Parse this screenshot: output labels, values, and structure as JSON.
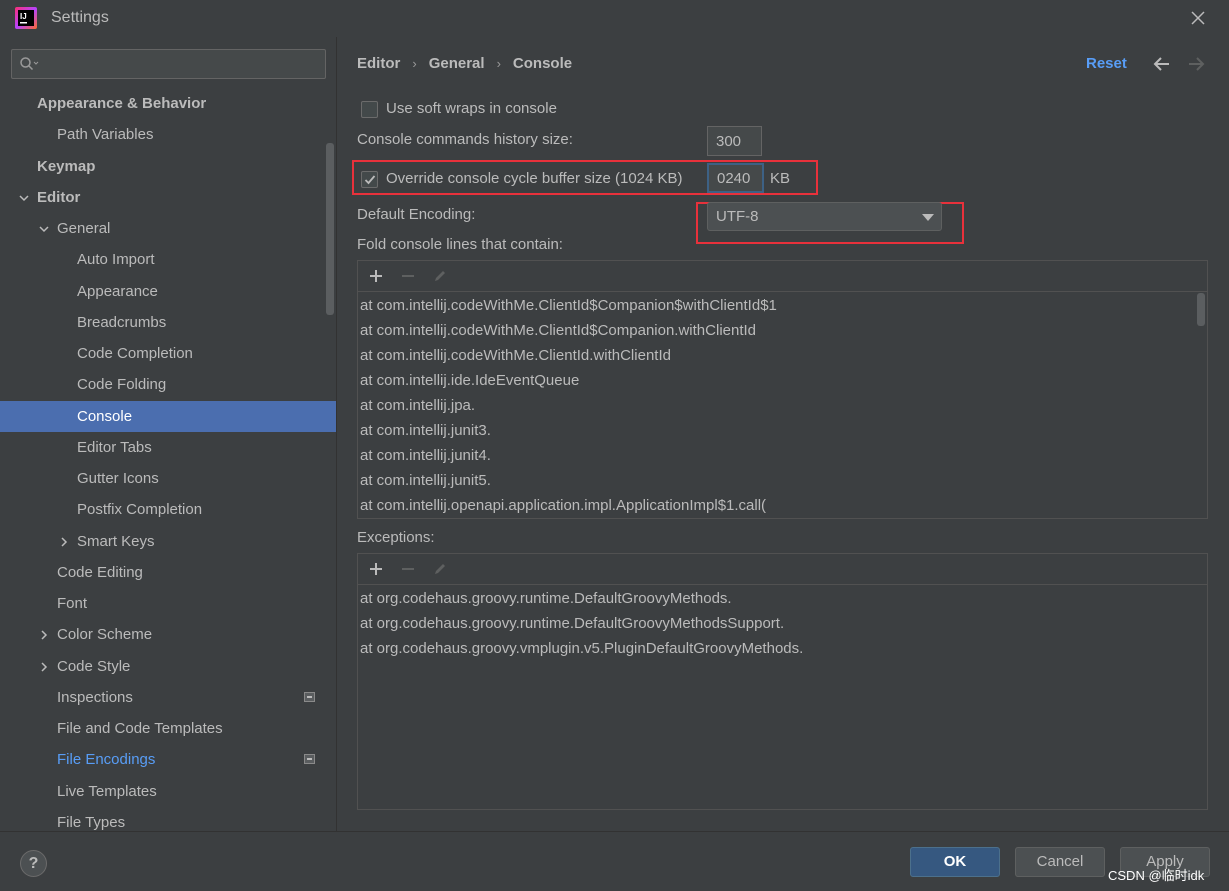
{
  "window": {
    "title": "Settings",
    "app_icon": "intellij-idea-icon",
    "close_icon": "close-icon"
  },
  "sidebar": {
    "search": {
      "value": "",
      "placeholder": ""
    },
    "items": [
      {
        "label": "Appearance & Behavior",
        "expanded": false,
        "selected": false
      },
      {
        "label": "Path Variables"
      },
      {
        "label": "Keymap"
      },
      {
        "label": "Editor",
        "expanded": true
      },
      {
        "label": "General",
        "expanded": true
      },
      {
        "label": "Auto Import"
      },
      {
        "label": "Appearance"
      },
      {
        "label": "Breadcrumbs"
      },
      {
        "label": "Code Completion"
      },
      {
        "label": "Code Folding"
      },
      {
        "label": "Console",
        "selected": true
      },
      {
        "label": "Editor Tabs"
      },
      {
        "label": "Gutter Icons"
      },
      {
        "label": "Postfix Completion"
      },
      {
        "label": "Smart Keys",
        "expanded": false
      },
      {
        "label": "Code Editing"
      },
      {
        "label": "Font"
      },
      {
        "label": "Color Scheme",
        "expanded": false
      },
      {
        "label": "Code Style",
        "expanded": false
      },
      {
        "label": "Inspections",
        "badge": "project-scope-icon"
      },
      {
        "label": "File and Code Templates"
      },
      {
        "label": "File Encodings",
        "badge": "project-scope-icon",
        "modified": true
      },
      {
        "label": "Live Templates"
      },
      {
        "label": "File Types"
      }
    ]
  },
  "breadcrumb": [
    "Editor",
    "General",
    "Console"
  ],
  "header": {
    "reset_label": "Reset",
    "back_icon": "arrow-left-icon",
    "forward_icon": "arrow-right-icon"
  },
  "settings": {
    "soft_wraps": {
      "label": "Use soft wraps in console",
      "checked": false
    },
    "history_size": {
      "label": "Console commands history size:",
      "value": "300"
    },
    "override_buffer": {
      "label": "Override console cycle buffer size (1024 KB)",
      "checked": true,
      "value": "0240",
      "unit": "KB"
    },
    "encoding": {
      "label": "Default Encoding:",
      "value": "UTF-8"
    },
    "fold_lines": {
      "label": "Fold console lines that contain:",
      "toolbar": [
        "add-icon",
        "remove-icon",
        "edit-icon"
      ],
      "rows": [
        "at com.intellij.codeWithMe.ClientId$Companion$withClientId$1",
        "at com.intellij.codeWithMe.ClientId$Companion.withClientId",
        "at com.intellij.codeWithMe.ClientId.withClientId",
        "at com.intellij.ide.IdeEventQueue",
        "at com.intellij.jpa.",
        "at com.intellij.junit3.",
        "at com.intellij.junit4.",
        "at com.intellij.junit5.",
        "at com.intellij.openapi.application.impl.ApplicationImpl$1.call("
      ]
    },
    "exceptions": {
      "label": "Exceptions:",
      "toolbar": [
        "add-icon",
        "remove-icon",
        "edit-icon"
      ],
      "rows": [
        "at org.codehaus.groovy.runtime.DefaultGroovyMethods.",
        "at org.codehaus.groovy.runtime.DefaultGroovyMethodsSupport.",
        "at org.codehaus.groovy.vmplugin.v5.PluginDefaultGroovyMethods."
      ]
    }
  },
  "footer": {
    "help_label": "?",
    "ok_label": "OK",
    "cancel_label": "Cancel",
    "apply_label": "Apply"
  },
  "watermark": "CSDN @临时idk",
  "colors": {
    "background": "#3c3f41",
    "selection": "#4b6eaf",
    "link": "#589df6",
    "highlight_box": "#e8313b",
    "primary_button": "#365880"
  }
}
